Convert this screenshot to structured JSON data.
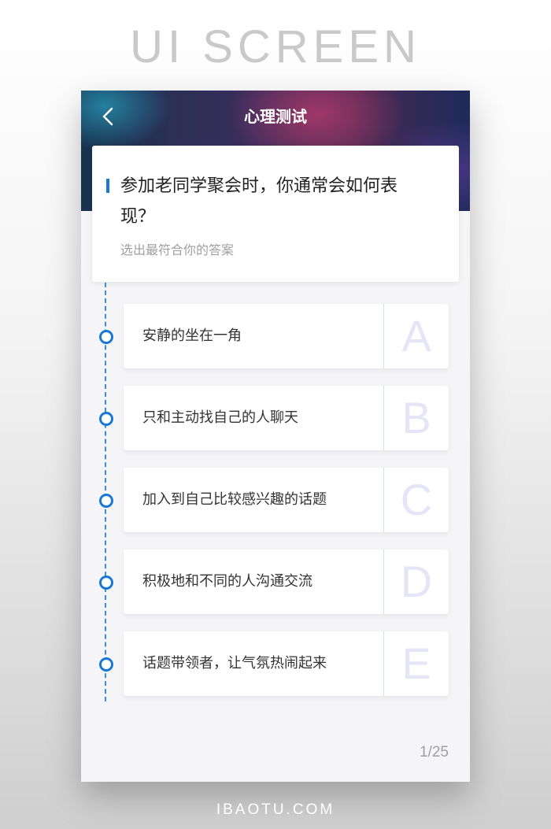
{
  "heading": "UI SCREEN",
  "footer": "IBAOTU.COM",
  "nav": {
    "title": "心理测试",
    "back_icon": "chevron-left-icon"
  },
  "question": {
    "text": "参加老同学聚会时，你通常会如何表现？",
    "subtitle": "选出最符合你的答案"
  },
  "options": [
    {
      "letter": "A",
      "text": "安静的坐在一角"
    },
    {
      "letter": "B",
      "text": "只和主动找自己的人聊天"
    },
    {
      "letter": "C",
      "text": "加入到自己比较感兴趣的话题"
    },
    {
      "letter": "D",
      "text": "积极地和不同的人沟通交流"
    },
    {
      "letter": "E",
      "text": "话题带领者，让气氛热闹起来"
    }
  ],
  "progress": {
    "label": "1/25",
    "current": 1,
    "total": 25
  },
  "colors": {
    "accent": "#1a78d4",
    "letter": "#e6e4f7"
  }
}
